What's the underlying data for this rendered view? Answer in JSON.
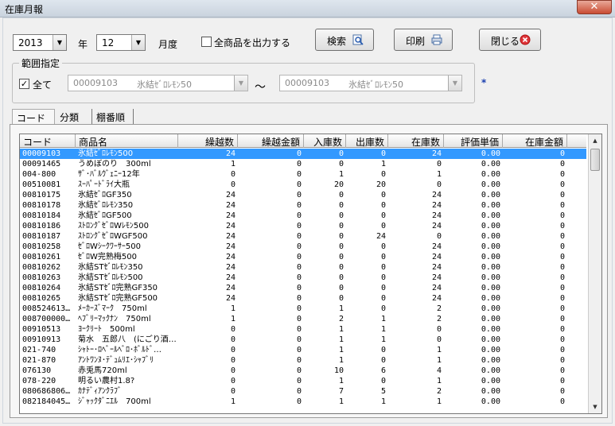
{
  "window": {
    "title": "在庫月報",
    "close_glyph": "✕"
  },
  "filters": {
    "year": "2013",
    "year_label": "年",
    "month": "12",
    "month_label": "月度",
    "all_products_label": "全商品を出力する",
    "all_products_checked": false
  },
  "buttons": {
    "search": "検索",
    "print": "印刷",
    "close": "閉じる"
  },
  "range": {
    "legend": "範囲指定",
    "all_label": "全て",
    "all_checked": true,
    "from_code": "00009103",
    "from_name": "氷結ｾﾞﾛﾚﾓﾝ50",
    "tilde": "～",
    "to_code": "00009103",
    "to_name": "氷結ｾﾞﾛﾚﾓﾝ50",
    "asterisk": "*"
  },
  "tabs": [
    "コード順",
    "分類順",
    "棚番順"
  ],
  "grid": {
    "columns": [
      "コード",
      "商品名",
      "繰越数",
      "繰越金額",
      "入庫数",
      "出庫数",
      "在庫数",
      "評価単価",
      "在庫金額"
    ],
    "selected_row": 0,
    "rows": [
      [
        "00009103",
        "氷結ｾﾞﾛﾚﾓﾝ500",
        "24",
        "0",
        "0",
        "0",
        "24",
        "0.00",
        "0"
      ],
      [
        "00091465",
        "うめぼのり　300ml",
        "1",
        "0",
        "0",
        "1",
        "0",
        "0.00",
        "0"
      ],
      [
        "004-800",
        "ｻﾞ･ﾊﾞﾙｳﾞｪﾆｰ12年",
        "0",
        "0",
        "1",
        "0",
        "1",
        "0.00",
        "0"
      ],
      [
        "00510081",
        "ｽｰﾊﾟｰﾄﾞﾗｲ大瓶",
        "0",
        "0",
        "20",
        "20",
        "0",
        "0.00",
        "0"
      ],
      [
        "00810175",
        "氷結ｾﾞﾛGF350",
        "24",
        "0",
        "0",
        "0",
        "24",
        "0.00",
        "0"
      ],
      [
        "00810178",
        "氷結ｾﾞﾛﾚﾓﾝ350",
        "24",
        "0",
        "0",
        "0",
        "24",
        "0.00",
        "0"
      ],
      [
        "00810184",
        "氷結ｾﾞﾛGF500",
        "24",
        "0",
        "0",
        "0",
        "24",
        "0.00",
        "0"
      ],
      [
        "00810186",
        "ｽﾄﾛﾝｸﾞｾﾞﾛWﾚﾓﾝ500",
        "24",
        "0",
        "0",
        "0",
        "24",
        "0.00",
        "0"
      ],
      [
        "00810187",
        "ｽﾄﾛﾝｸﾞｾﾞﾛWGF500",
        "24",
        "0",
        "0",
        "24",
        "0",
        "0.00",
        "0"
      ],
      [
        "00810258",
        "ｾﾞﾛWｼｰｸﾜｰｻｰ500",
        "24",
        "0",
        "0",
        "0",
        "24",
        "0.00",
        "0"
      ],
      [
        "00810261",
        "ｾﾞﾛW完熟梅500",
        "24",
        "0",
        "0",
        "0",
        "24",
        "0.00",
        "0"
      ],
      [
        "00810262",
        "氷結STｾﾞﾛﾚﾓﾝ350",
        "24",
        "0",
        "0",
        "0",
        "24",
        "0.00",
        "0"
      ],
      [
        "00810263",
        "氷結STｾﾞﾛﾚﾓﾝ500",
        "24",
        "0",
        "0",
        "0",
        "24",
        "0.00",
        "0"
      ],
      [
        "00810264",
        "氷結STｾﾞﾛ完熟GF350",
        "24",
        "0",
        "0",
        "0",
        "24",
        "0.00",
        "0"
      ],
      [
        "00810265",
        "氷結STｾﾞﾛ完熟GF500",
        "24",
        "0",
        "0",
        "0",
        "24",
        "0.00",
        "0"
      ],
      [
        "008524613…",
        "ﾒｰｶｰｽﾞﾏｰｸ　750ml",
        "1",
        "0",
        "1",
        "0",
        "2",
        "0.00",
        "0"
      ],
      [
        "008700000…",
        "ﾍﾌﾞﾘｰﾏｯｸﾅﾝ　750ml",
        "1",
        "0",
        "2",
        "1",
        "2",
        "0.00",
        "0"
      ],
      [
        "00910513",
        "ﾖｰｸﾘｰﾄ　500ml",
        "0",
        "0",
        "1",
        "1",
        "0",
        "0.00",
        "0"
      ],
      [
        "00910913",
        "菊水　五郎八　(にごり酒…",
        "0",
        "0",
        "1",
        "1",
        "0",
        "0.00",
        "0"
      ],
      [
        "021-740",
        "ｼｬﾄｰ･ﾛﾍﾞｰﾙﾍﾞﾛ･ﾎﾞﾙﾄﾞ…",
        "0",
        "0",
        "1",
        "0",
        "1",
        "0.00",
        "0"
      ],
      [
        "021-870",
        "ｱﾝﾄﾜﾝﾇ･ﾃﾞｭﾑﾘｴ･ｼｬﾌﾞﾘ",
        "0",
        "0",
        "1",
        "0",
        "1",
        "0.00",
        "0"
      ],
      [
        "076130",
        "赤兎馬720ml",
        "0",
        "0",
        "10",
        "6",
        "4",
        "0.00",
        "0"
      ],
      [
        "078-220",
        "明るい農村1.8?",
        "0",
        "0",
        "1",
        "0",
        "1",
        "0.00",
        "0"
      ],
      [
        "080686806…",
        "ｶﾅﾃﾞｨｱﾝｸﾗﾌﾞ",
        "0",
        "0",
        "7",
        "5",
        "2",
        "0.00",
        "0"
      ],
      [
        "082184045…",
        "ｼﾞｬｯｸﾀﾞﾆｴﾙ　700ml",
        "1",
        "0",
        "1",
        "1",
        "1",
        "0.00",
        "0"
      ]
    ]
  }
}
